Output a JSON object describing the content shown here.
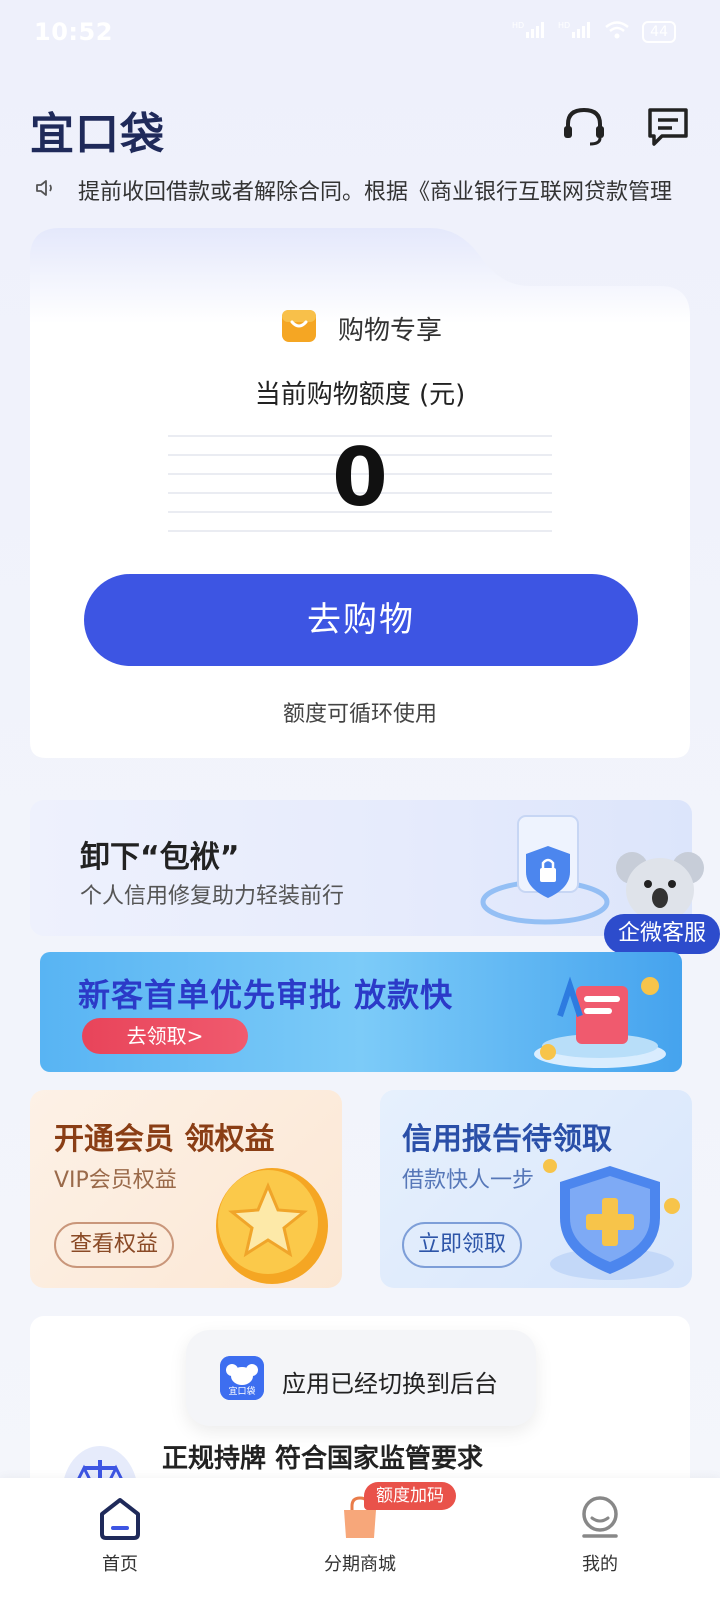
{
  "status_bar": {
    "time": "10:52",
    "battery": "44",
    "signal1": "HD",
    "signal2": "HD"
  },
  "header": {
    "logo": "宜口袋"
  },
  "notice": {
    "text": "提前收回借款或者解除合同。根据《商业银行互联网贷款管理"
  },
  "card": {
    "shop_title": "购物专享",
    "limit_label": "当前购物额度 (元)",
    "limit_value": "0",
    "go_button": "去购物",
    "recycle_note": "额度可循环使用"
  },
  "banner1": {
    "title": "卸下“包袱”",
    "subtitle": "个人信用修复助力轻装前行"
  },
  "kefu": {
    "label": "企微客服"
  },
  "banner2": {
    "title": "新客首单优先审批 放款快",
    "button": "去领取>"
  },
  "vip": {
    "title": "开通会员 领权益",
    "subtitle": "VIP会员权益",
    "button": "查看权益"
  },
  "credit": {
    "title": "信用报告待领取",
    "subtitle": "借款快人一步",
    "button": "立即领取"
  },
  "toast": {
    "text": "应用已经切换到后台",
    "icon_text": "宜口袋"
  },
  "regulation": {
    "text": "正规持牌 符合国家监管要求"
  },
  "tabs": [
    {
      "label": "首页",
      "icon": "home-icon"
    },
    {
      "label": "分期商城",
      "icon": "shopping-bag-icon",
      "badge": "额度加码"
    },
    {
      "label": "我的",
      "icon": "profile-icon"
    }
  ],
  "colors": {
    "primary": "#3d55e3",
    "kefu": "#2d4ccc",
    "badge": "#e9524a"
  }
}
